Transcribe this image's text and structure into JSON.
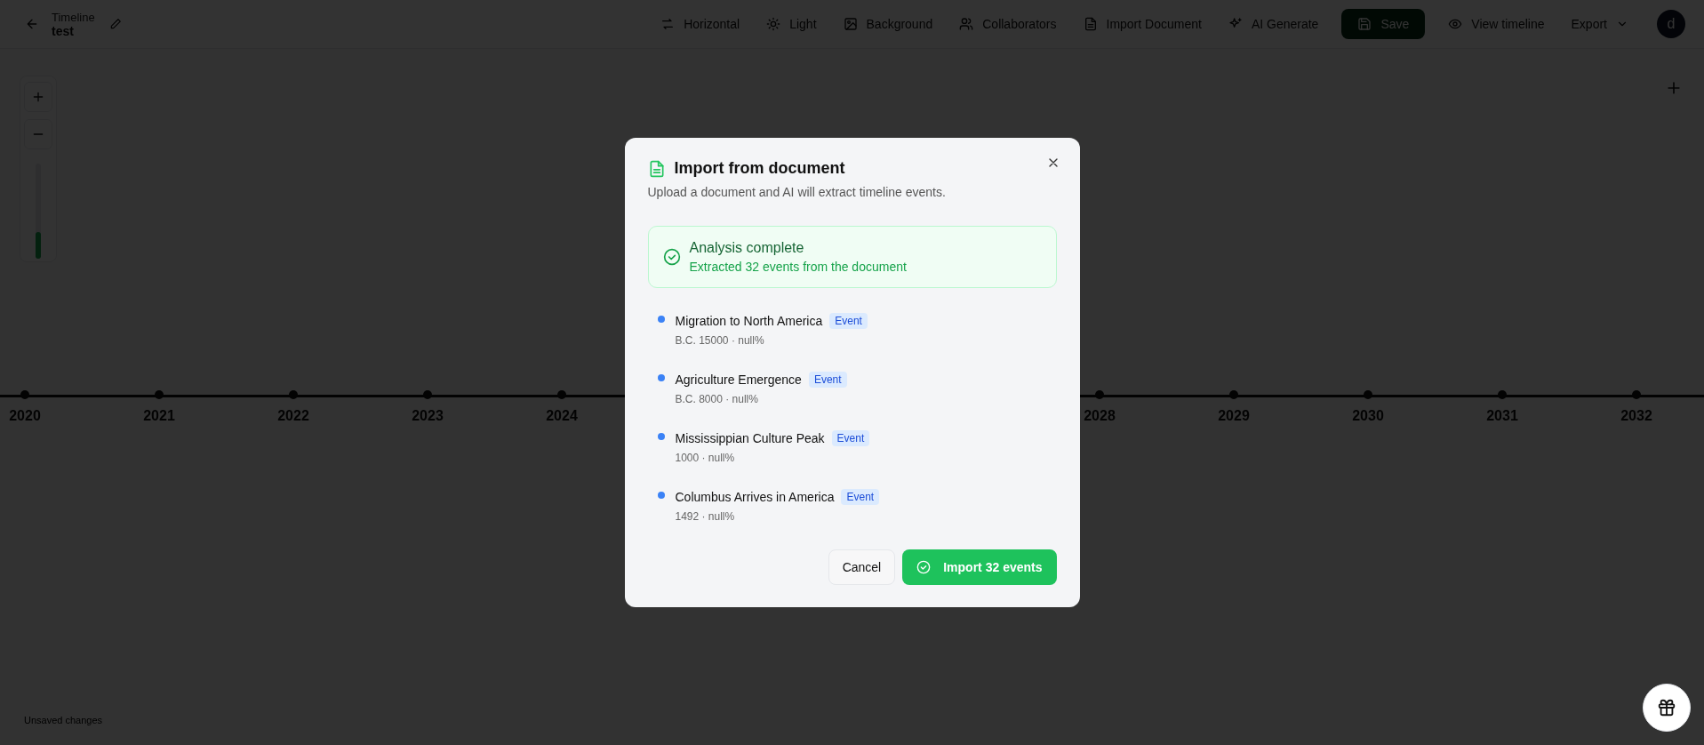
{
  "header": {
    "title_label": "Timeline",
    "title": "test"
  },
  "toolbar": [
    {
      "kind": "orientation",
      "label": "Horizontal"
    },
    {
      "kind": "theme",
      "label": "Light"
    },
    {
      "kind": "background",
      "label": "Background"
    },
    {
      "kind": "collaborators",
      "label": "Collaborators"
    },
    {
      "kind": "import",
      "label": "Import Document"
    },
    {
      "kind": "ai",
      "label": "AI Generate"
    },
    {
      "kind": "save",
      "label": "Save"
    },
    {
      "kind": "view",
      "label": "View timeline"
    },
    {
      "kind": "export",
      "label": "Export"
    }
  ],
  "avatar": {
    "initial": "d"
  },
  "zoom": {
    "level": 0.28
  },
  "axis": {
    "left_years": [
      "2020",
      "2021",
      "2022",
      "2023",
      "2024"
    ],
    "right_years": [
      "2028",
      "2029",
      "2030",
      "2031",
      "2032"
    ]
  },
  "status": "Unsaved changes",
  "dialog": {
    "title": "Import from document",
    "subtitle": "Upload a document and AI will extract timeline events.",
    "alert": {
      "title": "Analysis complete",
      "message": "Extracted 32 events from the document"
    },
    "events": [
      {
        "title": "Migration to North America",
        "badge": "Event",
        "meta": "B.C. 15000 · null%"
      },
      {
        "title": "Agriculture Emergence",
        "badge": "Event",
        "meta": "B.C. 8000 · null%"
      },
      {
        "title": "Mississippian Culture Peak",
        "badge": "Event",
        "meta": "1000 · null%"
      },
      {
        "title": "Columbus Arrives in America",
        "badge": "Event",
        "meta": "1492 · null%"
      }
    ],
    "cancel": "Cancel",
    "confirm": "Import 32 events"
  }
}
